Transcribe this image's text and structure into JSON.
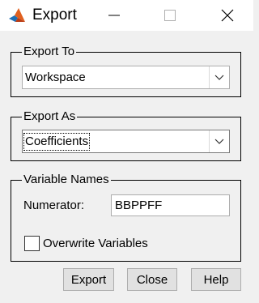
{
  "window": {
    "title": "Export",
    "app_icon": "matlab-logo-icon",
    "controls": [
      "minimize-icon",
      "maximize-icon",
      "close-icon"
    ]
  },
  "export_to": {
    "legend": "Export To",
    "selected": "Workspace"
  },
  "export_as": {
    "legend": "Export As",
    "selected": "Coefficients"
  },
  "variable_names": {
    "legend": "Variable Names",
    "numerator_label": "Numerator:",
    "numerator_value": "BBPPFF",
    "overwrite_label": "Overwrite Variables",
    "overwrite_checked": false
  },
  "buttons": {
    "export": "Export",
    "close": "Close",
    "help": "Help"
  }
}
